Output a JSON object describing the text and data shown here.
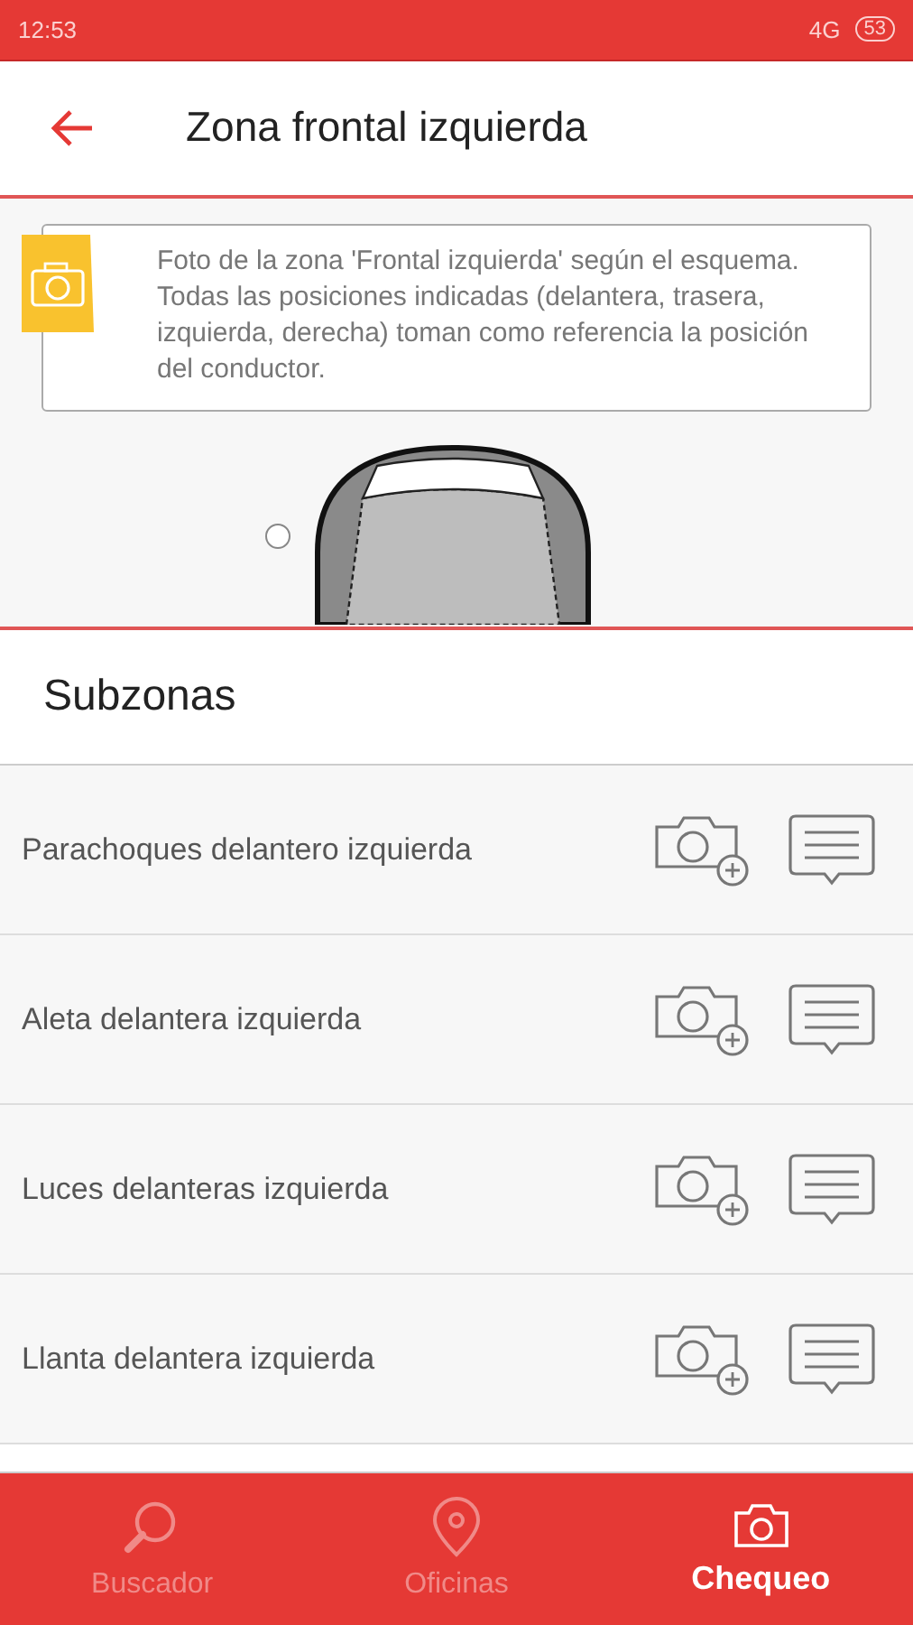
{
  "status_bar": {
    "time": "12:53",
    "network": "4G",
    "battery": "53"
  },
  "header": {
    "title": "Zona frontal izquierda"
  },
  "info": {
    "text": "Foto de la zona 'Frontal izquierda' según el esquema. Todas las posiciones indicadas (delantera, trasera, izquierda, derecha) toman como referencia la posición del conductor."
  },
  "section_title": "Subzonas",
  "subzones": [
    {
      "label": "Parachoques delantero izquierda"
    },
    {
      "label": "Aleta delantera izquierda"
    },
    {
      "label": "Luces delanteras izquierda"
    },
    {
      "label": "Llanta delantera izquierda"
    }
  ],
  "nav": [
    {
      "label": "Buscador",
      "selected": false
    },
    {
      "label": "Oficinas",
      "selected": false
    },
    {
      "label": "Chequeo",
      "selected": true
    }
  ]
}
